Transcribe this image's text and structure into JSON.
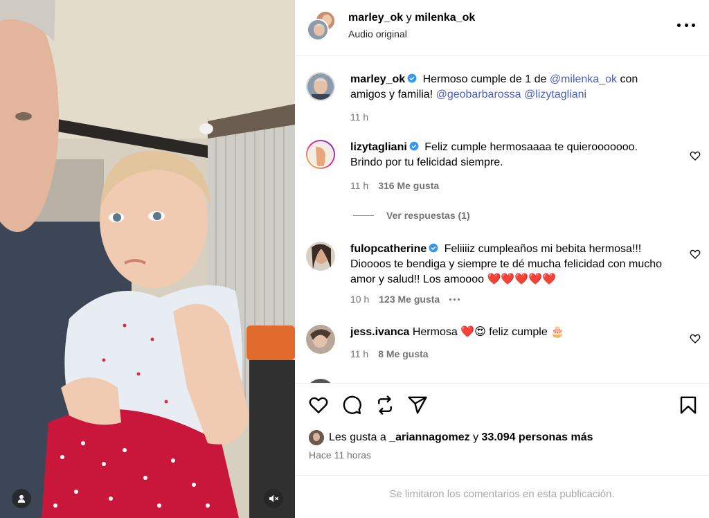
{
  "header": {
    "user1": "marley_ok",
    "conjunction": "y",
    "user2": "milenka_ok",
    "subtitle": "Audio original"
  },
  "caption": {
    "user": "marley_ok",
    "text_before": " Hermoso cumple de 1 de ",
    "mention1": "@milenka_ok",
    "text_middle": " con amigos y familia! ",
    "mention2": "@geobarbarossa",
    "space": " ",
    "mention3": "@lizytagliani",
    "time": "11 h"
  },
  "comments": [
    {
      "user": "lizytagliani",
      "text": " Feliz cumple hermosaaaa te quierooooooo. Brindo por tu felicidad siempre.",
      "time": "11 h",
      "likes": "316 Me gusta",
      "replies": "Ver respuestas (1)"
    },
    {
      "user": "fulopcatherine",
      "text": " Feliiiiz cumpleaños mi bebita hermosa!!! Dioooos te bendiga y siempre te dé mucha felicidad con mucho amor y salud!! Los amoooo ❤️❤️❤️❤️❤️",
      "time": "10 h",
      "likes": "123 Me gusta"
    },
    {
      "user": "jess.ivanca",
      "text": " Hermosa ❤️😍 feliz cumple 🎂",
      "time": "11 h",
      "likes": "8 Me gusta"
    }
  ],
  "likes_summary": {
    "prefix": "Les gusta a ",
    "user": "_ariannagomez",
    "middle": " y ",
    "count": "33.094 personas más"
  },
  "posted_ago": "Hace 11 horas",
  "comments_limited": "Se limitaron los comentarios en esta publicación.",
  "colors": {
    "verified": "#3897f0",
    "mention": "#4a5fc1",
    "secondary_text": "#737373",
    "heart_red": "#e0245e"
  },
  "icons": [
    "heart-icon",
    "comment-icon",
    "repost-icon",
    "share-icon",
    "bookmark-icon",
    "user-tag-icon",
    "mute-icon",
    "more-icon",
    "verified-icon"
  ]
}
